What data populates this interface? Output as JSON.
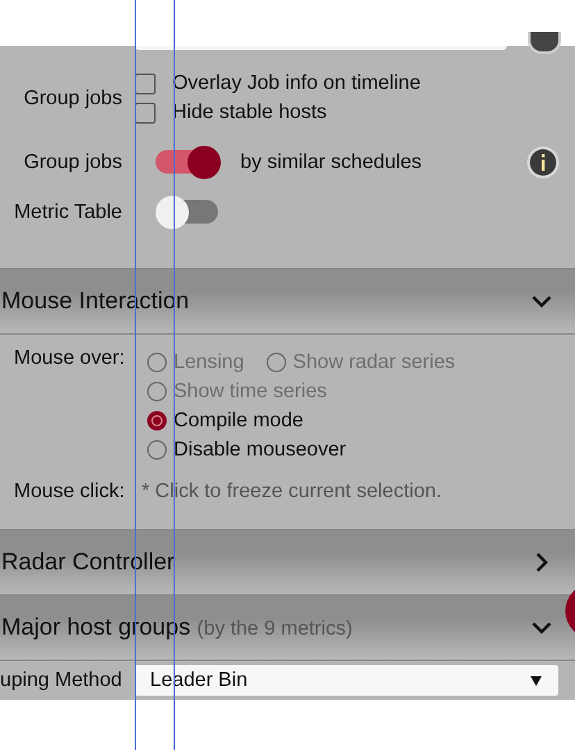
{
  "top_panel": {
    "group_jobs_label": "Group jobs",
    "checkboxes": [
      {
        "label": "Overlay Job info on timeline",
        "checked": false
      },
      {
        "label": "Hide stable hosts",
        "checked": false
      }
    ],
    "toggles": [
      {
        "label": "Group jobs",
        "on": true,
        "caption": "by similar schedules",
        "info": true
      },
      {
        "label": "Metric Table",
        "on": false
      }
    ]
  },
  "mouse_interaction": {
    "title": "Mouse Interaction",
    "expanded": true,
    "mouse_over_label": "Mouse over:",
    "option_rows": [
      [
        {
          "label": "Lensing",
          "selected": false,
          "disabled": true
        },
        {
          "label": "Show radar series",
          "selected": false,
          "disabled": true
        }
      ],
      [
        {
          "label": "Show time series",
          "selected": false,
          "disabled": true
        }
      ],
      [
        {
          "label": "Compile mode",
          "selected": true,
          "disabled": false
        }
      ],
      [
        {
          "label": "Disable mouseover",
          "selected": false,
          "disabled": false
        }
      ]
    ],
    "mouse_click_label": "Mouse click:",
    "mouse_click_text": "* Click to freeze current selection."
  },
  "radar_controller": {
    "title": "Radar Controller",
    "expanded": false
  },
  "major_host_groups": {
    "title": "Major host groups",
    "subtitle": "(by the 9 metrics)",
    "expanded": true,
    "grouping_label": "uping Method",
    "grouping_value": "Leader Bin"
  }
}
